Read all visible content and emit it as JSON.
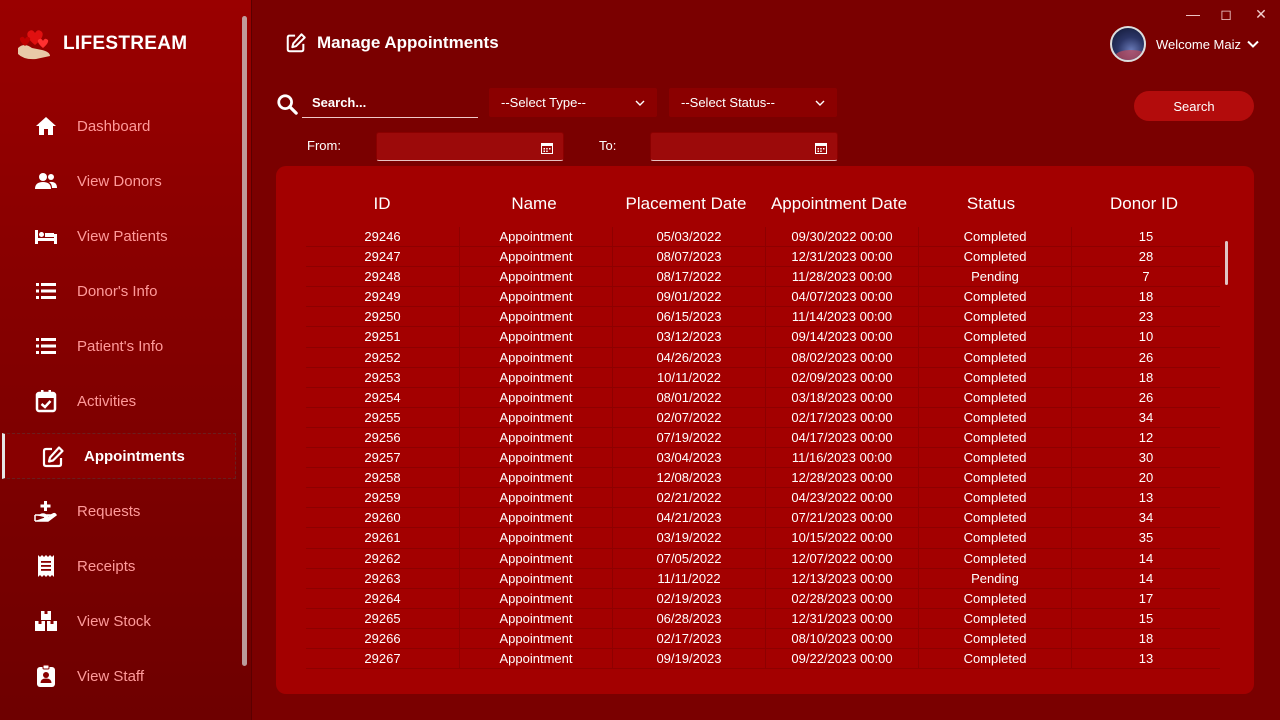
{
  "app": {
    "name": "LIFESTREAM"
  },
  "sidebar": {
    "items": [
      {
        "label": "Dashboard",
        "icon": "home-icon"
      },
      {
        "label": "View Donors",
        "icon": "users-icon"
      },
      {
        "label": "View Patients",
        "icon": "bed-icon"
      },
      {
        "label": "Donor's Info",
        "icon": "list-icon"
      },
      {
        "label": "Patient's Info",
        "icon": "list-icon"
      },
      {
        "label": "Activities",
        "icon": "calendar-check-icon"
      },
      {
        "label": "Appointments",
        "icon": "edit-icon",
        "active": true
      },
      {
        "label": "Requests",
        "icon": "hand-plus-icon"
      },
      {
        "label": "Receipts",
        "icon": "receipt-icon"
      },
      {
        "label": "View Stock",
        "icon": "boxes-icon"
      },
      {
        "label": "View Staff",
        "icon": "badge-icon"
      }
    ]
  },
  "header": {
    "title": "Manage Appointments",
    "welcome": "Welcome Maiz"
  },
  "filters": {
    "search_placeholder": "Search...",
    "type_select": "--Select Type--",
    "status_select": "--Select Status--",
    "from_label": "From:",
    "to_label": "To:",
    "search_button": "Search"
  },
  "table": {
    "columns": [
      "ID",
      "Name",
      "Placement Date",
      "Appointment Date",
      "Status",
      "Donor ID"
    ],
    "rows": [
      [
        "29246",
        "Appointment",
        "05/03/2022",
        "09/30/2022 00:00",
        "Completed",
        "15"
      ],
      [
        "29247",
        "Appointment",
        "08/07/2023",
        "12/31/2023 00:00",
        "Completed",
        "28"
      ],
      [
        "29248",
        "Appointment",
        "08/17/2022",
        "11/28/2023 00:00",
        "Pending",
        "7"
      ],
      [
        "29249",
        "Appointment",
        "09/01/2022",
        "04/07/2023 00:00",
        "Completed",
        "18"
      ],
      [
        "29250",
        "Appointment",
        "06/15/2023",
        "11/14/2023 00:00",
        "Completed",
        "23"
      ],
      [
        "29251",
        "Appointment",
        "03/12/2023",
        "09/14/2023 00:00",
        "Completed",
        "10"
      ],
      [
        "29252",
        "Appointment",
        "04/26/2023",
        "08/02/2023 00:00",
        "Completed",
        "26"
      ],
      [
        "29253",
        "Appointment",
        "10/11/2022",
        "02/09/2023 00:00",
        "Completed",
        "18"
      ],
      [
        "29254",
        "Appointment",
        "08/01/2022",
        "03/18/2023 00:00",
        "Completed",
        "26"
      ],
      [
        "29255",
        "Appointment",
        "02/07/2022",
        "02/17/2023 00:00",
        "Completed",
        "34"
      ],
      [
        "29256",
        "Appointment",
        "07/19/2022",
        "04/17/2023 00:00",
        "Completed",
        "12"
      ],
      [
        "29257",
        "Appointment",
        "03/04/2023",
        "11/16/2023 00:00",
        "Completed",
        "30"
      ],
      [
        "29258",
        "Appointment",
        "12/08/2023",
        "12/28/2023 00:00",
        "Completed",
        "20"
      ],
      [
        "29259",
        "Appointment",
        "02/21/2022",
        "04/23/2022 00:00",
        "Completed",
        "13"
      ],
      [
        "29260",
        "Appointment",
        "04/21/2023",
        "07/21/2023 00:00",
        "Completed",
        "34"
      ],
      [
        "29261",
        "Appointment",
        "03/19/2022",
        "10/15/2022 00:00",
        "Completed",
        "35"
      ],
      [
        "29262",
        "Appointment",
        "07/05/2022",
        "12/07/2022 00:00",
        "Completed",
        "14"
      ],
      [
        "29263",
        "Appointment",
        "11/11/2022",
        "12/13/2023 00:00",
        "Pending",
        "14"
      ],
      [
        "29264",
        "Appointment",
        "02/19/2023",
        "02/28/2023 00:00",
        "Completed",
        "17"
      ],
      [
        "29265",
        "Appointment",
        "06/28/2023",
        "12/31/2023 00:00",
        "Completed",
        "15"
      ],
      [
        "29266",
        "Appointment",
        "02/17/2023",
        "08/10/2023 00:00",
        "Completed",
        "18"
      ],
      [
        "29267",
        "Appointment",
        "09/19/2023",
        "09/22/2023 00:00",
        "Completed",
        "13"
      ]
    ]
  }
}
